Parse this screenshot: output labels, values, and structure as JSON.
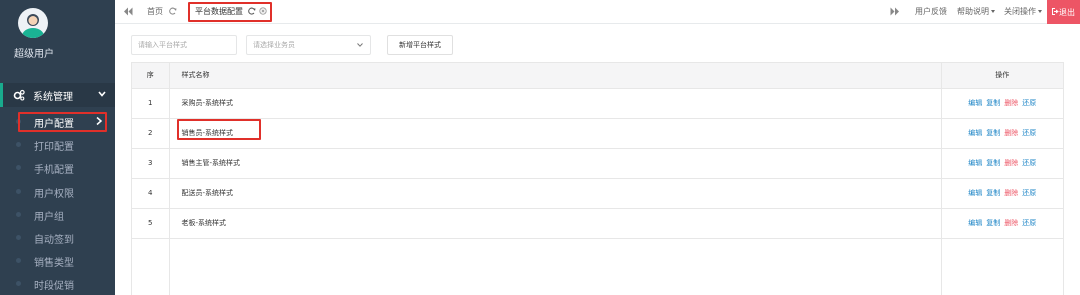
{
  "sidebar": {
    "user_name": "超级用户",
    "group_label": "系统管理",
    "items": [
      {
        "label": "用户配置",
        "active": true
      },
      {
        "label": "打印配置"
      },
      {
        "label": "手机配置"
      },
      {
        "label": "用户权限"
      },
      {
        "label": "用户组"
      },
      {
        "label": "自动签到"
      },
      {
        "label": "销售类型"
      },
      {
        "label": "时段促销"
      }
    ]
  },
  "topbar": {
    "home_tab": "首页",
    "active_tab": "平台数据配置",
    "feedback": "用户反馈",
    "help": "帮助说明",
    "close_ops": "关闭操作",
    "logout": "退出"
  },
  "toolbar": {
    "search_placeholder": "请输入平台样式",
    "salesperson_placeholder": "请选择业务员",
    "add_button": "新增平台样式"
  },
  "table": {
    "headers": {
      "index": "序",
      "name": "样式名称",
      "ops": "操作"
    },
    "actions": {
      "edit": "编辑",
      "copy": "复制",
      "delete": "删除",
      "restore": "还原"
    },
    "rows": [
      {
        "index": "1",
        "name": "采购员-系统样式"
      },
      {
        "index": "2",
        "name": "销售员-系统样式"
      },
      {
        "index": "3",
        "name": "销售主管-系统样式"
      },
      {
        "index": "4",
        "name": "配送员-系统样式"
      },
      {
        "index": "5",
        "name": "老板-系统样式"
      }
    ]
  },
  "colors": {
    "sidebar_bg": "#2f4050",
    "highlight": "#e0302a",
    "link": "#1c84c6",
    "danger": "#ed5565"
  },
  "icons": {
    "group": "cogs-icon",
    "refresh": "refresh-icon",
    "close": "close-circle-icon",
    "back": "double-chevron-left-icon",
    "forward": "double-chevron-right-icon",
    "logout": "sign-out-icon"
  }
}
